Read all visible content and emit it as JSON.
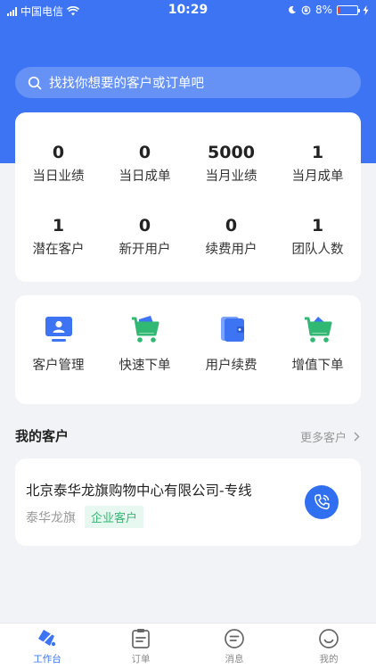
{
  "status_bar": {
    "carrier": "中国电信",
    "time": "10:29",
    "battery": "8%",
    "battery_level": 0.08
  },
  "search": {
    "placeholder": "找找你想要的客户或订单吧"
  },
  "stats": [
    {
      "value": "0",
      "label": "当日业绩"
    },
    {
      "value": "0",
      "label": "当日成单"
    },
    {
      "value": "5000",
      "label": "当月业绩"
    },
    {
      "value": "1",
      "label": "当月成单"
    },
    {
      "value": "1",
      "label": "潜在客户"
    },
    {
      "value": "0",
      "label": "新开用户"
    },
    {
      "value": "0",
      "label": "续费用户"
    },
    {
      "value": "1",
      "label": "团队人数"
    }
  ],
  "shortcuts": [
    {
      "label": "客户管理",
      "icon": "monitor-user-icon"
    },
    {
      "label": "快速下单",
      "icon": "cart-icon"
    },
    {
      "label": "用户续费",
      "icon": "wallet-icon"
    },
    {
      "label": "增值下单",
      "icon": "cart-plus-icon"
    }
  ],
  "my_customers": {
    "title": "我的客户",
    "more": "更多客户",
    "items": [
      {
        "name": "北京泰华龙旗购物中心有限公司-专线",
        "short_name": "泰华龙旗",
        "tag": "企业客户"
      }
    ]
  },
  "tabbar": [
    {
      "label": "工作台",
      "icon": "workbench-icon",
      "active": true
    },
    {
      "label": "订单",
      "icon": "order-icon",
      "active": false
    },
    {
      "label": "消息",
      "icon": "message-icon",
      "active": false
    },
    {
      "label": "我的",
      "icon": "profile-icon",
      "active": false
    }
  ],
  "colors": {
    "primary": "#3c74f4",
    "accent_green": "#31b872",
    "tag_bg": "#e6f8ef"
  }
}
